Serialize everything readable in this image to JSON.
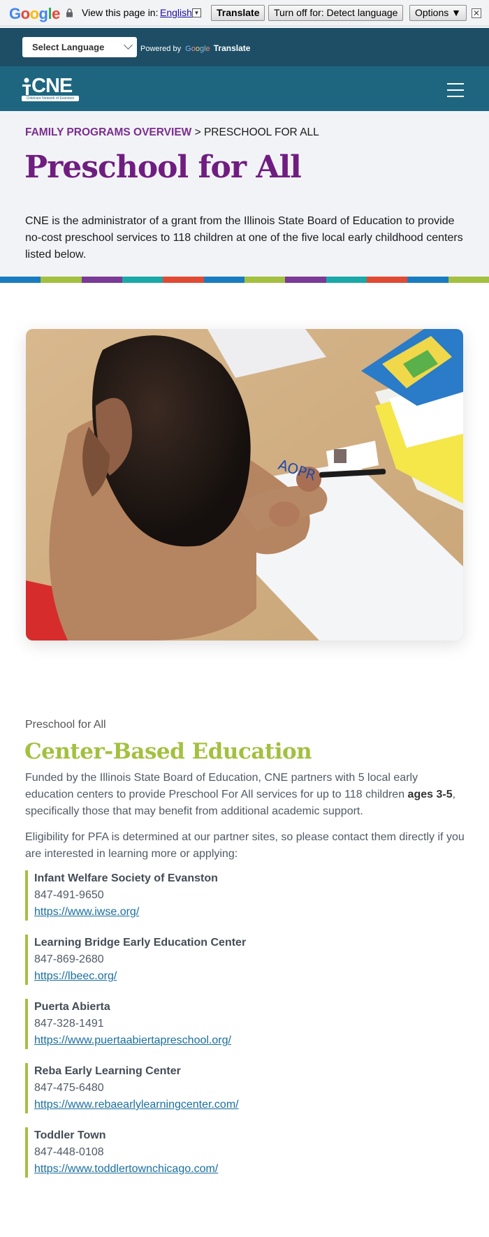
{
  "translate_bar": {
    "logo": "Google",
    "view_text": "View this page in:",
    "language": "English",
    "translate_btn": "Translate",
    "turn_off_btn": "Turn off for: Detect language",
    "options_btn": "Options ▼",
    "close": "✕"
  },
  "language_bar": {
    "select_label": "Select Language",
    "powered_by": "Powered by",
    "google": "Google",
    "translate": "Translate"
  },
  "nav": {
    "logo_text": "CNE",
    "logo_sub": "Childcare Network of Evanston"
  },
  "hero": {
    "breadcrumb_parent": "FAMILY PROGRAMS OVERVIEW",
    "breadcrumb_sep": " > ",
    "breadcrumb_current": "PRESCHOOL FOR ALL",
    "title": "Preschool for All",
    "intro": "CNE is the administrator of a grant from the Illinois State Board of Education to provide no-cost preschool services to 118 children at one of the five local early childhood centers listed below."
  },
  "stripe_colors": [
    "#1a7cc0",
    "#a3c040",
    "#7a3a96",
    "#1aa8a8",
    "#e04a35",
    "#1a7cc0",
    "#a3c040",
    "#7a3a96",
    "#1aa8a8",
    "#e04a35",
    "#1a7cc0",
    "#a3c040"
  ],
  "content": {
    "eyebrow": "Preschool for All",
    "title": "Center-Based Education",
    "para1_a": "Funded by the Illinois State Board of Education, CNE partners with 5 local early education centers to provide Preschool For All services for up to 118 children ",
    "para1_bold": "ages 3-5",
    "para1_b": ", specifically those that may benefit from additional academic support.",
    "para2": "Eligibility for PFA is determined at our partner sites, so please contact them directly if you are interested in learning more or applying:",
    "centers": [
      {
        "name": "Infant Welfare Society of Evanston",
        "phone": "847-491-9650",
        "url": "https://www.iwse.org/"
      },
      {
        "name": "Learning Bridge Early Education Center",
        "phone": "847-869-2680",
        "url": "https://lbeec.org/"
      },
      {
        "name": "Puerta Abierta",
        "phone": "847-328-1491",
        "url": "https://www.puertaabiertapreschool.org/"
      },
      {
        "name": "Reba Early Learning Center",
        "phone": "847-475-6480",
        "url": "https://www.rebaearlylearningcenter.com/"
      },
      {
        "name": "Toddler Town",
        "phone": "847-448-0108",
        "url": "https://www.toddlertownchicago.com/"
      }
    ]
  }
}
